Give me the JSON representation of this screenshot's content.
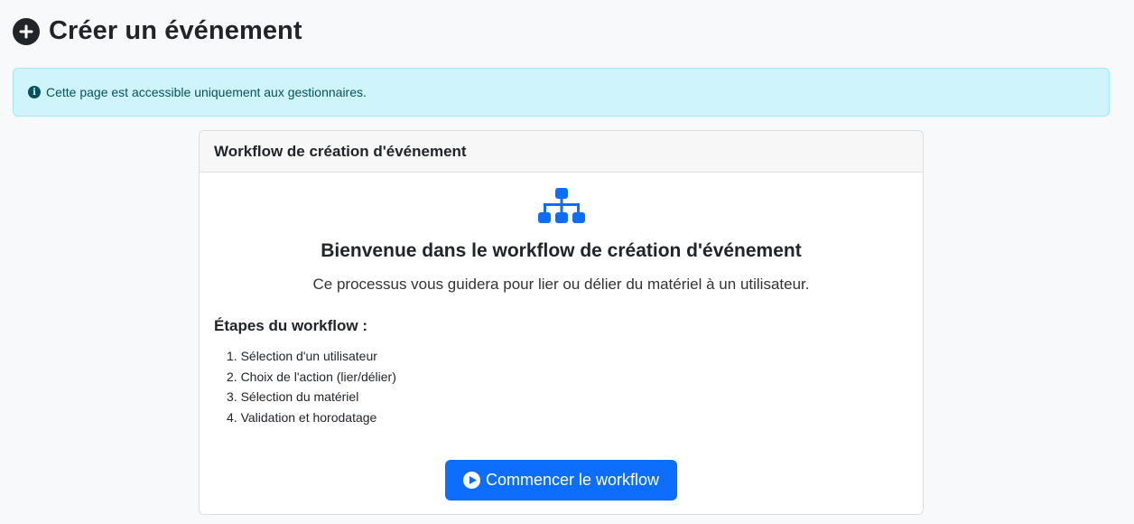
{
  "header": {
    "icon": "plus-circle-icon",
    "title": "Créer un événement"
  },
  "alert": {
    "icon": "info-circle-icon",
    "text": "Cette page est accessible uniquement aux gestionnaires.",
    "color": "#055160",
    "background": "#cff4fc"
  },
  "card": {
    "header": "Workflow de création d'événement",
    "icon": "sitemap-icon",
    "icon_color": "#0d6efd",
    "welcome_title": "Bienvenue dans le workflow de création d'événement",
    "welcome_subtitle": "Ce processus vous guidera pour lier ou délier du matériel à un utilisateur.",
    "steps_title": "Étapes du workflow :",
    "steps": [
      "1. Sélection d'un utilisateur",
      "2. Choix de l'action (lier/délier)",
      "3. Sélection du matériel",
      "4. Validation et horodatage"
    ],
    "start_button": {
      "icon": "play-circle-icon",
      "label": "Commencer le workflow",
      "color": "#0d6efd"
    }
  }
}
